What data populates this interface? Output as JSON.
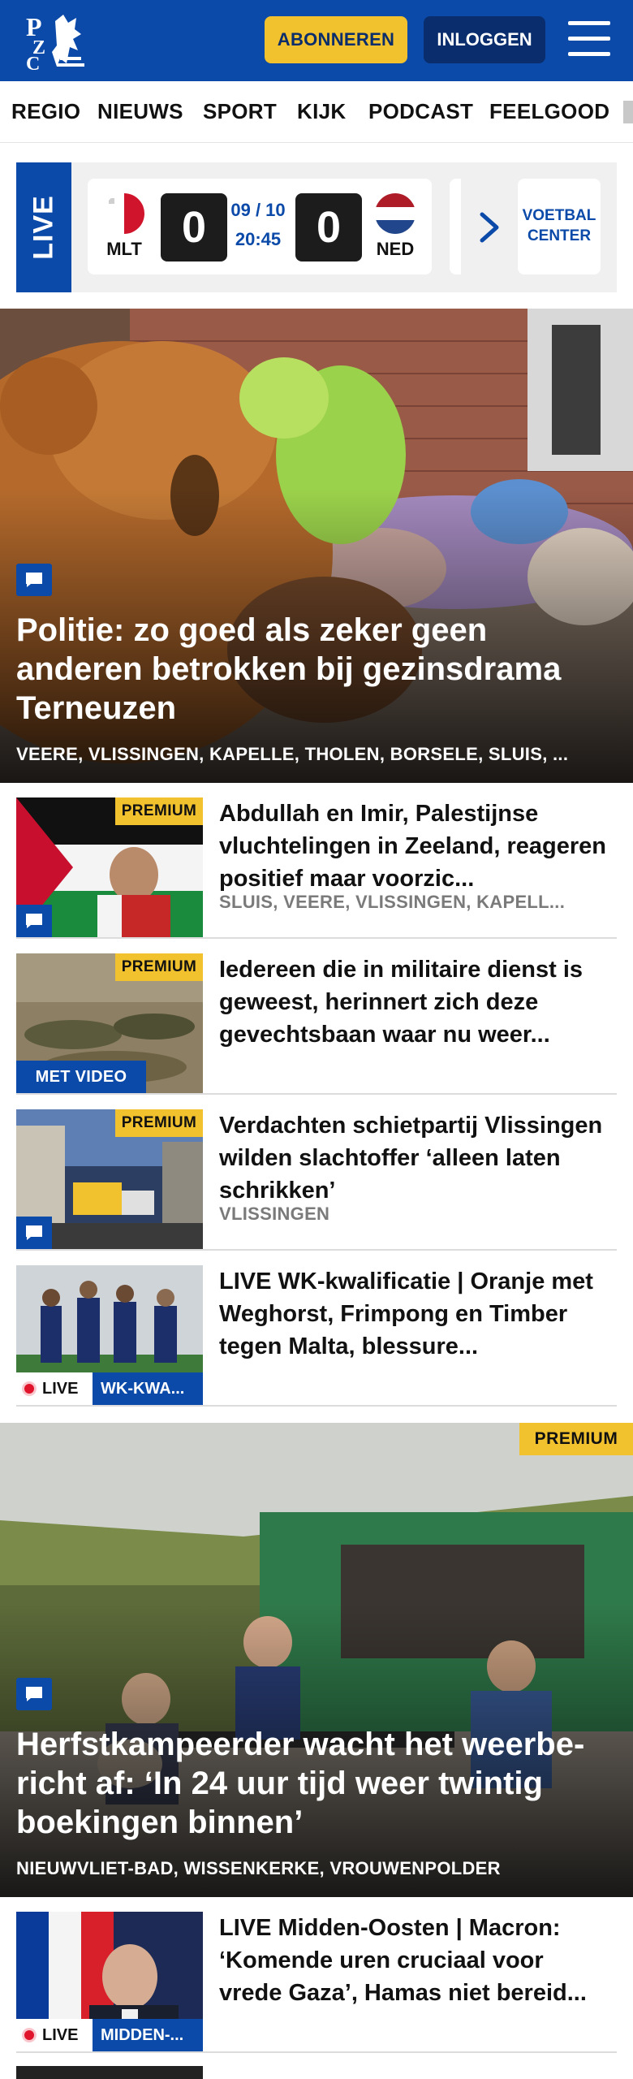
{
  "header": {
    "subscribe_label": "ABONNEREN",
    "login_label": "INLOGGEN",
    "brand_color": "#0b4aa8",
    "accent_color": "#f2c12e"
  },
  "nav": {
    "items": [
      "REGIO",
      "NIEUWS",
      "SPORT",
      "KIJK",
      "PODCAST",
      "FEELGOOD"
    ]
  },
  "live_bar": {
    "label": "LIVE",
    "match": {
      "home_code": "MLT",
      "home_score": "0",
      "date": "09 / 10",
      "time": "20:45",
      "away_score": "0",
      "away_code": "NED"
    },
    "center_label": "VOETBAL CENTER"
  },
  "hero": {
    "title": "Politie: zo goed als zeker geen anderen betrokken bij gezinsdrama Terneuzen",
    "locations": "VEERE, VLISSINGEN, KAPELLE, THOLEN, BORSELE, SLUIS, ..."
  },
  "articles": [
    {
      "badge": "PREMIUM",
      "title": "Abdullah en Imir, Palestijnse vluchtelingen in Zeeland, reageren positief maar voorzic...",
      "locations": "SLUIS, VEERE, VLISSINGEN, KAPELL..."
    },
    {
      "badge": "PREMIUM",
      "video_label": "MET VIDEO",
      "title": "Iedereen die in militaire dienst is geweest, herinnert zich deze gevechtsbaan waar nu weer..."
    },
    {
      "badge": "PREMIUM",
      "title": "Verdachten schietpartij Vlissingen wilden slachtoffer ‘alleen laten schrikken’",
      "locations": "VLISSINGEN"
    },
    {
      "live_label": "LIVE",
      "category": "WK-KWA...",
      "title": "LIVE WK-kwalificatie | Oranje met Weghorst, Frimpong en Timber tegen Malta, blessure..."
    }
  ],
  "feature": {
    "badge": "PREMIUM",
    "title": "Herfstkampeerder wacht het weerbe­richt af: ‘In 24 uur tijd weer twintig boekingen binnen’",
    "locations": "NIEUWVLIET-BAD, WISSENKERKE, VROUWENPOLDER"
  },
  "article_bottom": {
    "live_label": "LIVE",
    "category": "MIDDEN-...",
    "title": "LIVE Midden-Oosten | Macron: ‘Komende uren cruciaal voor vrede Gaza’, Hamas niet bereid..."
  }
}
